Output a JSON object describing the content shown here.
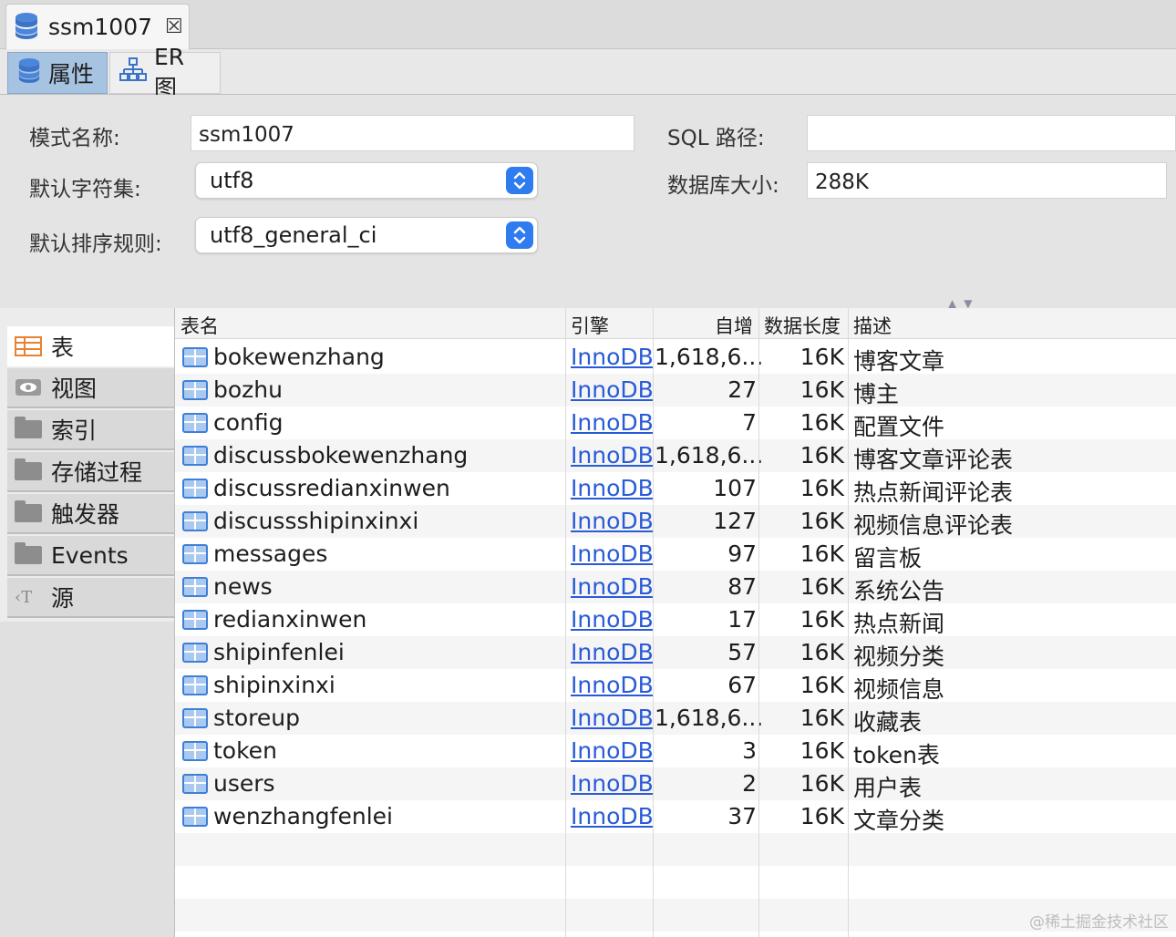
{
  "window_tab": {
    "title": "ssm1007",
    "close_glyph": "☒"
  },
  "subtabs": {
    "properties": "属性",
    "er": "ER 图"
  },
  "form": {
    "schema_name_label": "模式名称:",
    "schema_name_value": "ssm1007",
    "charset_label": "默认字符集:",
    "charset_value": "utf8",
    "collation_label": "默认排序规则:",
    "collation_value": "utf8_general_ci",
    "sql_path_label": "SQL 路径:",
    "sql_path_value": "",
    "db_size_label": "数据库大小:",
    "db_size_value": "288K"
  },
  "nav": {
    "items": [
      {
        "label": "表",
        "icon": "table-icon"
      },
      {
        "label": "视图",
        "icon": "view-icon"
      },
      {
        "label": "索引",
        "icon": "folder-icon"
      },
      {
        "label": "存储过程",
        "icon": "folder-icon"
      },
      {
        "label": "触发器",
        "icon": "folder-icon"
      },
      {
        "label": "Events",
        "icon": "folder-icon"
      },
      {
        "label": "源",
        "icon": "source-icon"
      }
    ]
  },
  "table": {
    "headers": {
      "name": "表名",
      "engine": "引擎",
      "auto_inc": "自增",
      "data_len": "数据长度",
      "desc": "描述"
    },
    "rows": [
      {
        "name": "bokewenzhang",
        "engine": "InnoDB",
        "auto_inc": "1,618,6...",
        "data_len": "16K",
        "desc": "博客文章"
      },
      {
        "name": "bozhu",
        "engine": "InnoDB",
        "auto_inc": "27",
        "data_len": "16K",
        "desc": "博主"
      },
      {
        "name": "config",
        "engine": "InnoDB",
        "auto_inc": "7",
        "data_len": "16K",
        "desc": "配置文件"
      },
      {
        "name": "discussbokewenzhang",
        "engine": "InnoDB",
        "auto_inc": "1,618,6...",
        "data_len": "16K",
        "desc": "博客文章评论表"
      },
      {
        "name": "discussredianxinwen",
        "engine": "InnoDB",
        "auto_inc": "107",
        "data_len": "16K",
        "desc": "热点新闻评论表"
      },
      {
        "name": "discussshipinxinxi",
        "engine": "InnoDB",
        "auto_inc": "127",
        "data_len": "16K",
        "desc": "视频信息评论表"
      },
      {
        "name": "messages",
        "engine": "InnoDB",
        "auto_inc": "97",
        "data_len": "16K",
        "desc": "留言板"
      },
      {
        "name": "news",
        "engine": "InnoDB",
        "auto_inc": "87",
        "data_len": "16K",
        "desc": "系统公告"
      },
      {
        "name": "redianxinwen",
        "engine": "InnoDB",
        "auto_inc": "17",
        "data_len": "16K",
        "desc": "热点新闻"
      },
      {
        "name": "shipinfenlei",
        "engine": "InnoDB",
        "auto_inc": "57",
        "data_len": "16K",
        "desc": "视频分类"
      },
      {
        "name": "shipinxinxi",
        "engine": "InnoDB",
        "auto_inc": "67",
        "data_len": "16K",
        "desc": "视频信息"
      },
      {
        "name": "storeup",
        "engine": "InnoDB",
        "auto_inc": "1,618,6...",
        "data_len": "16K",
        "desc": "收藏表"
      },
      {
        "name": "token",
        "engine": "InnoDB",
        "auto_inc": "3",
        "data_len": "16K",
        "desc": "token表"
      },
      {
        "name": "users",
        "engine": "InnoDB",
        "auto_inc": "2",
        "data_len": "16K",
        "desc": "用户表"
      },
      {
        "name": "wenzhangfenlei",
        "engine": "InnoDB",
        "auto_inc": "37",
        "data_len": "16K",
        "desc": "文章分类"
      }
    ]
  },
  "watermark": "@稀土掘金技术社区",
  "colors": {
    "accent": "#2f7bf0",
    "link": "#2a5bd7",
    "selected_tab": "#a7c3e2"
  }
}
